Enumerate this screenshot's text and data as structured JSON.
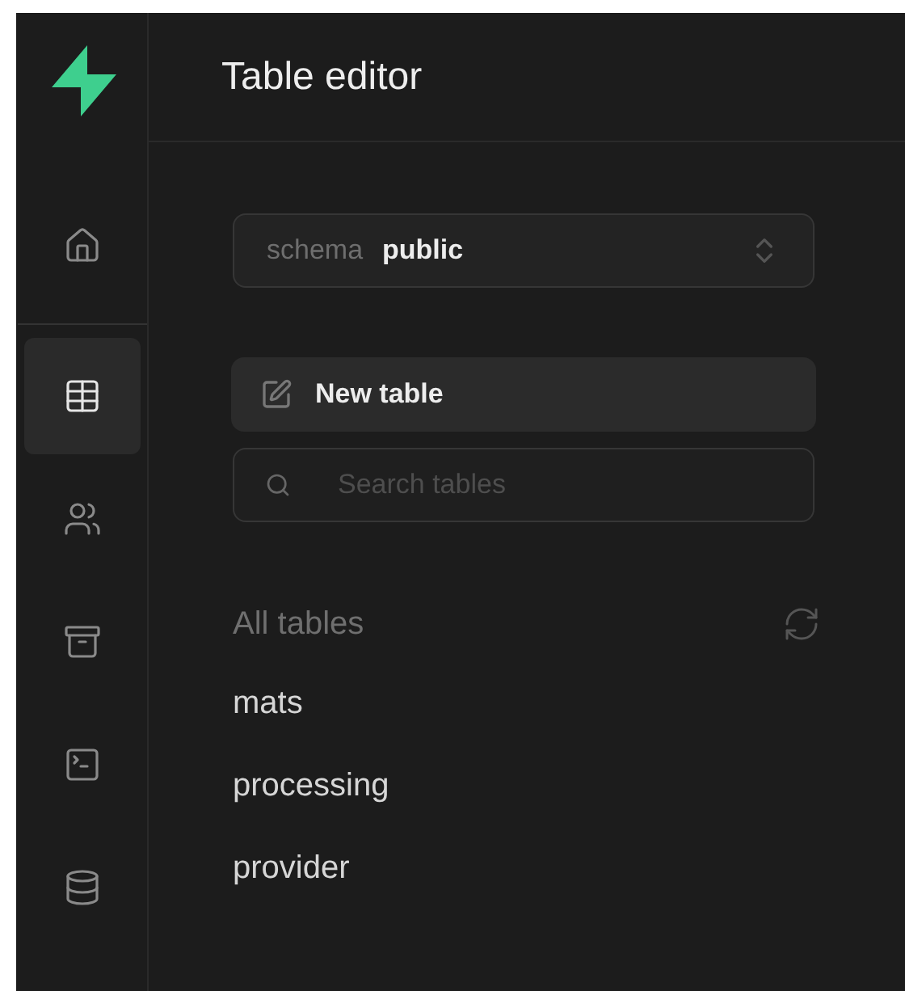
{
  "sidebar": {
    "items": [
      {
        "kind": "home",
        "selected": false
      },
      {
        "kind": "table",
        "selected": true
      },
      {
        "kind": "users",
        "selected": false
      },
      {
        "kind": "archive",
        "selected": false
      },
      {
        "kind": "terminal",
        "selected": false
      },
      {
        "kind": "database",
        "selected": false
      }
    ]
  },
  "header": {
    "title": "Table editor"
  },
  "schema_select": {
    "label": "schema",
    "value": "public"
  },
  "new_table_button": {
    "label": "New table"
  },
  "search": {
    "placeholder": "Search tables"
  },
  "tables_section": {
    "title": "All tables",
    "tables": [
      "mats",
      "processing",
      "provider"
    ]
  }
}
